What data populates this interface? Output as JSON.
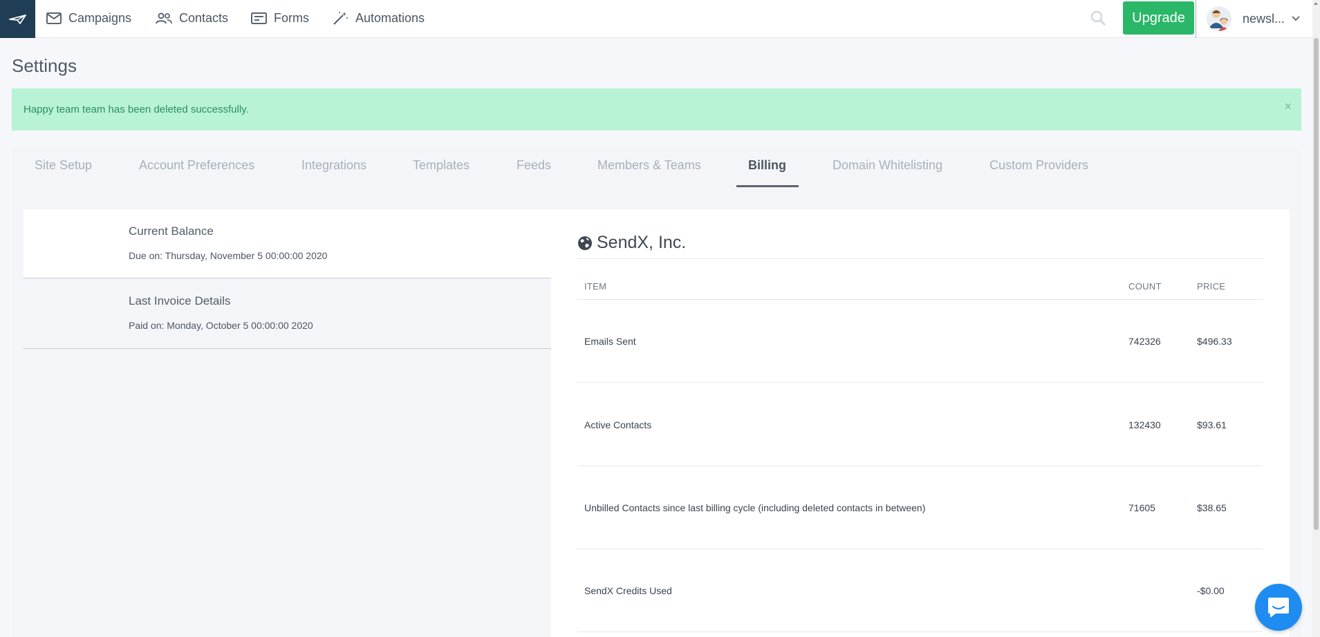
{
  "nav": {
    "items": [
      {
        "label": "Campaigns",
        "icon": "mail-icon"
      },
      {
        "label": "Contacts",
        "icon": "people-icon"
      },
      {
        "label": "Forms",
        "icon": "form-icon"
      },
      {
        "label": "Automations",
        "icon": "magic-wand-icon"
      }
    ],
    "upgrade_label": "Upgrade",
    "user_name": "newsl..."
  },
  "page": {
    "title": "Settings",
    "alert": "Happy team team has been deleted successfully.",
    "alert_close": "×"
  },
  "tabs": [
    {
      "label": "Site Setup",
      "active": false
    },
    {
      "label": "Account Preferences",
      "active": false
    },
    {
      "label": "Integrations",
      "active": false
    },
    {
      "label": "Templates",
      "active": false
    },
    {
      "label": "Feeds",
      "active": false
    },
    {
      "label": "Members & Teams",
      "active": false
    },
    {
      "label": "Billing",
      "active": true
    },
    {
      "label": "Domain Whitelisting",
      "active": false
    },
    {
      "label": "Custom Providers",
      "active": false
    }
  ],
  "billing": {
    "current_balance": {
      "title": "Current Balance",
      "subtitle": "Due on: Thursday, November 5 00:00:00 2020"
    },
    "last_invoice": {
      "title": "Last Invoice Details",
      "subtitle": "Paid on: Monday, October 5 00:00:00 2020"
    },
    "company": "SendX, Inc.",
    "headers": {
      "item": "ITEM",
      "count": "COUNT",
      "price": "PRICE"
    },
    "rows": [
      {
        "item": "Emails Sent",
        "count": "742326",
        "price": "$496.33"
      },
      {
        "item": "Active Contacts",
        "count": "132430",
        "price": "$93.61"
      },
      {
        "item": "Unbilled Contacts since last billing cycle (including deleted contacts in between)",
        "count": "71605",
        "price": "$38.65"
      },
      {
        "item": "SendX Credits Used",
        "count": "",
        "price": "-$0.00"
      }
    ]
  },
  "colors": {
    "upgrade": "#2ab768",
    "alert_bg": "#b8f3d6",
    "logo_bg": "#1f3d55",
    "chat": "#1e8cf0"
  }
}
